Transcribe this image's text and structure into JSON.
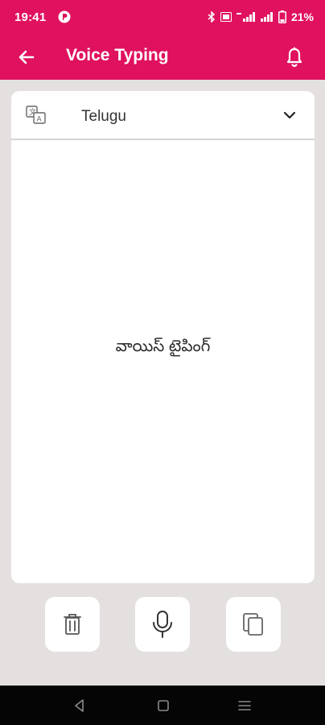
{
  "status_bar": {
    "time": "19:41",
    "battery_percent": "21%",
    "icons": [
      "app-notification-icon",
      "bluetooth-icon",
      "volte-icon",
      "signal-icon",
      "signal-icon",
      "battery-icon"
    ]
  },
  "app_bar": {
    "title": "Voice Typing",
    "back_icon": "arrow-left-icon",
    "notification_icon": "bell-icon",
    "color": "#e0115f"
  },
  "language_selector": {
    "icon": "translate-icon",
    "selected": "Telugu",
    "dropdown_icon": "chevron-down-icon"
  },
  "text_area": {
    "placeholder": "వాయిస్ టైపింగ్"
  },
  "actions": [
    {
      "name": "delete",
      "icon": "trash-icon"
    },
    {
      "name": "microphone",
      "icon": "microphone-icon"
    },
    {
      "name": "copy",
      "icon": "copy-icon"
    }
  ],
  "navigation": {
    "buttons": [
      "back-triangle-icon",
      "home-square-icon",
      "recents-lines-icon"
    ]
  }
}
